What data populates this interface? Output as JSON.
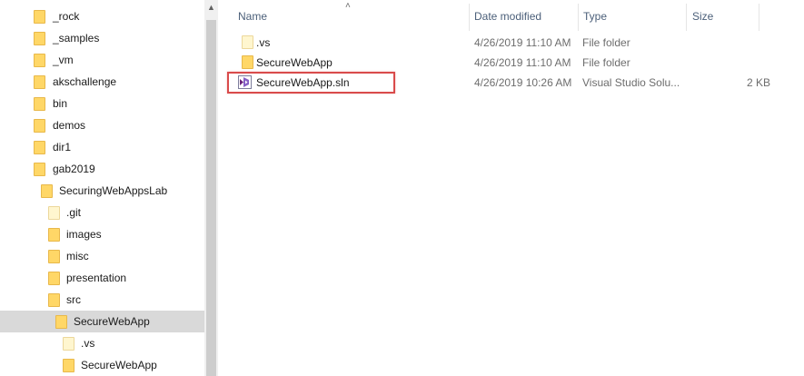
{
  "nav": {
    "items": [
      {
        "label": "_rock"
      },
      {
        "label": "_samples"
      },
      {
        "label": "_vm"
      },
      {
        "label": "akschallenge"
      },
      {
        "label": "bin"
      },
      {
        "label": "demos"
      },
      {
        "label": "dir1"
      },
      {
        "label": "gab2019"
      },
      {
        "label": "SecuringWebAppsLab"
      },
      {
        "label": ".git"
      },
      {
        "label": "images"
      },
      {
        "label": "misc"
      },
      {
        "label": "presentation"
      },
      {
        "label": "src"
      },
      {
        "label": "SecureWebApp"
      },
      {
        "label": ".vs"
      },
      {
        "label": "SecureWebApp"
      }
    ],
    "selected_index": 14
  },
  "columns": {
    "name": "Name",
    "date_modified": "Date modified",
    "type": "Type",
    "size": "Size"
  },
  "files": [
    {
      "name": ".vs",
      "date": "4/26/2019 11:10 AM",
      "type": "File folder",
      "size": "",
      "icon": "folder-icon"
    },
    {
      "name": "SecureWebApp",
      "date": "4/26/2019 11:10 AM",
      "type": "File folder",
      "size": "",
      "icon": "folder-icon"
    },
    {
      "name": "SecureWebApp.sln",
      "date": "4/26/2019 10:26 AM",
      "type": "Visual Studio Solu...",
      "size": "2 KB",
      "icon": "visual-studio-solution-icon"
    }
  ],
  "colors": {
    "selection": "#d9d9d9",
    "highlight": "#d94b4b",
    "folder": "#ffd767",
    "header_text": "#4c607a"
  }
}
